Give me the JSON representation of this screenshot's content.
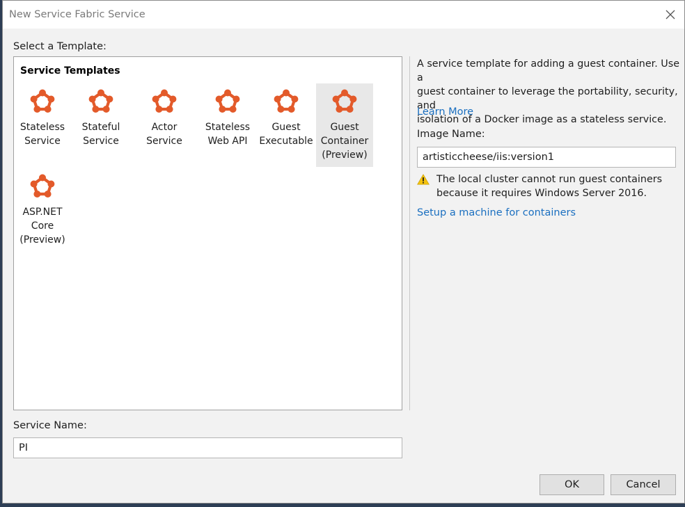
{
  "window": {
    "title": "New Service Fabric Service"
  },
  "select_template_label": "Select a Template:",
  "templates_header": "Service Templates",
  "templates": [
    {
      "label_lines": [
        "Stateless",
        "Service"
      ]
    },
    {
      "label_lines": [
        "Stateful",
        "Service"
      ]
    },
    {
      "label_lines": [
        "Actor Service"
      ]
    },
    {
      "label_lines": [
        "Stateless",
        "Web API"
      ]
    },
    {
      "label_lines": [
        "Guest",
        "Executable"
      ]
    },
    {
      "label_lines": [
        "Guest",
        "Container",
        "(Preview)"
      ],
      "selected": true
    },
    {
      "label_lines": [
        "ASP.NET",
        "Core",
        "(Preview)"
      ]
    }
  ],
  "icon_color": "#e35a2a",
  "description_lines": [
    "A service template for adding a guest container. Use a",
    "guest container to leverage the portability, security, and",
    "isolation of a Docker image as a stateless service."
  ],
  "learn_more": "Learn More",
  "image_name_label": "Image Name:",
  "image_name_value": "artisticcheese/iis:version1",
  "warning_lines": [
    "The local cluster cannot run guest containers",
    "because it requires Windows Server 2016."
  ],
  "setup_link": "Setup a machine for containers",
  "service_name_label": "Service Name:",
  "service_name_value": "PI",
  "buttons": {
    "ok": "OK",
    "cancel": "Cancel"
  }
}
